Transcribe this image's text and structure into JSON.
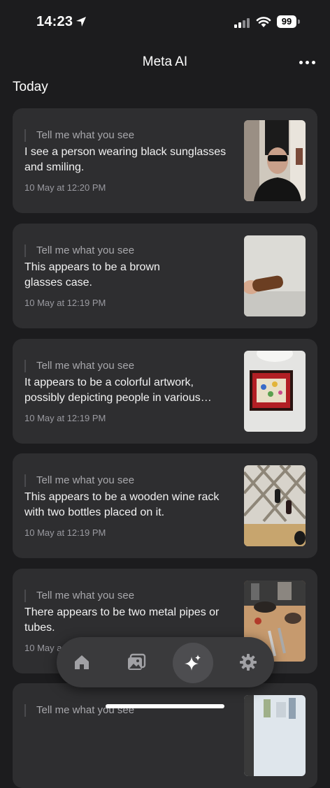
{
  "status_bar": {
    "time": "14:23",
    "battery": "99"
  },
  "header": {
    "title": "Meta AI"
  },
  "section": {
    "title": "Today"
  },
  "cards": [
    {
      "prompt": "Tell me what you see",
      "response": "I see a person wearing black sunglasses and smiling.",
      "time": "10 May at 12:20 PM",
      "thumb": "person-sunglasses"
    },
    {
      "prompt": "Tell me what you see",
      "response": "This appears to be a brown glasses case.",
      "time": "10 May at 12:19 PM",
      "thumb": "glasses-case"
    },
    {
      "prompt": "Tell me what you see",
      "response": "It appears to be a colorful artwork, possibly depicting people in various…",
      "time": "10 May at 12:19 PM",
      "thumb": "artwork"
    },
    {
      "prompt": "Tell me what you see",
      "response": "This appears to be a wooden wine rack with two bottles placed on it.",
      "time": "10 May at 12:19 PM",
      "thumb": "wine-rack"
    },
    {
      "prompt": "Tell me what you see",
      "response": "There appears to be two metal pipes or tubes.",
      "time": "10 May a",
      "thumb": "metal-pipes"
    },
    {
      "prompt": "Tell me what you see",
      "response": "",
      "time": "",
      "thumb": "city-view"
    }
  ],
  "tabbar": {
    "tabs": [
      "home-icon",
      "gallery-icon",
      "meta-ai-sparkle-icon",
      "settings-gear-icon"
    ],
    "active": "meta-ai-sparkle-icon"
  },
  "colors": {
    "background": "#1c1c1e",
    "card": "#2e2e30",
    "tabbar": "#3a3a3c"
  }
}
